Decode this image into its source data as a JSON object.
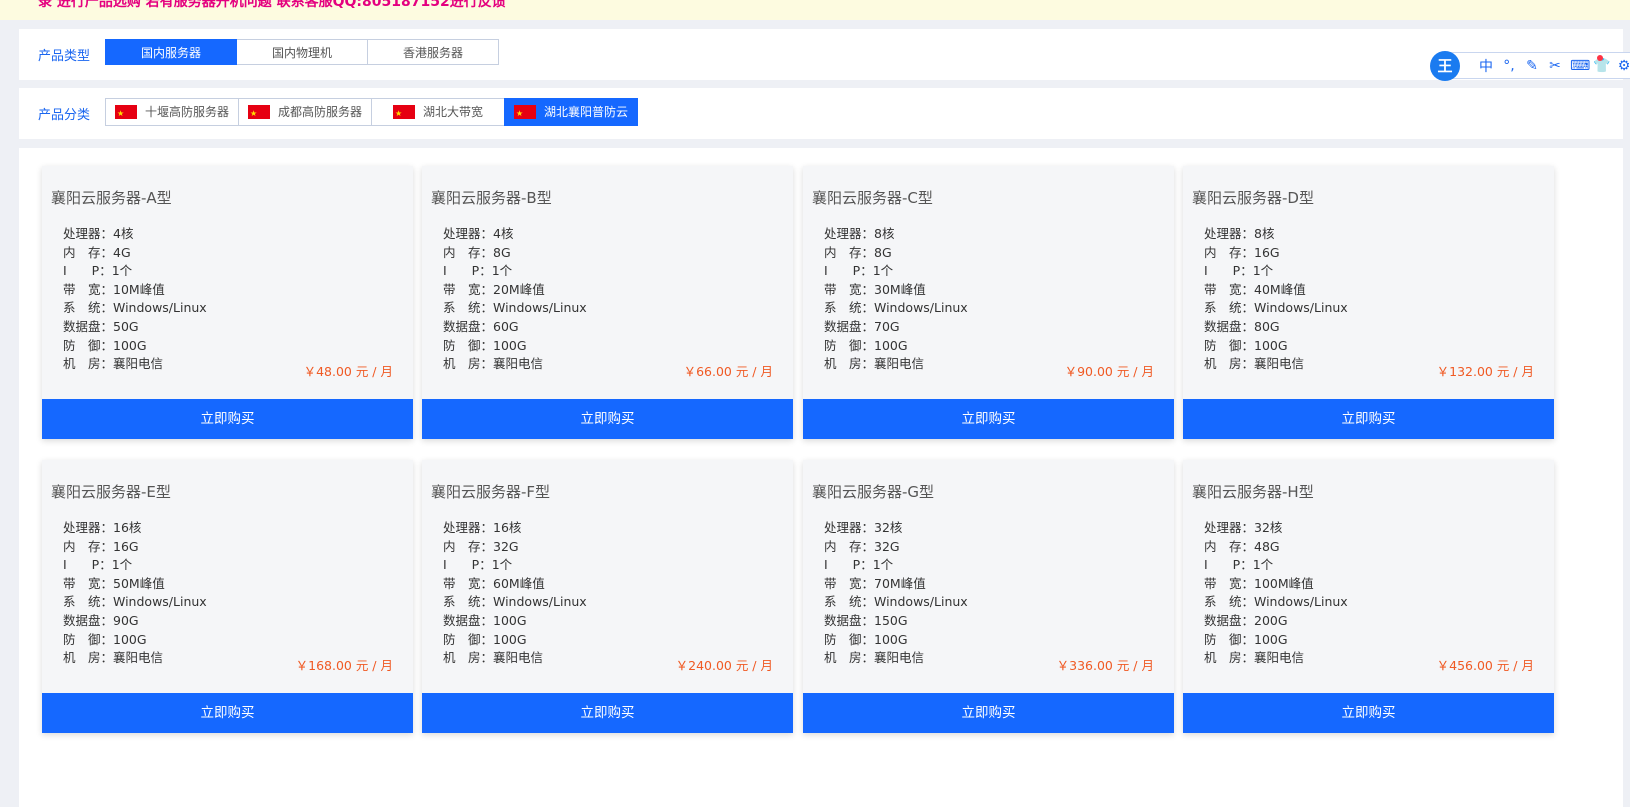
{
  "notice": "录 进行产品选购 若有服务器开机问题 联系客服QQ:805187152进行反馈",
  "product_type": {
    "label": "产品类型",
    "tabs": [
      "国内服务器",
      "国内物理机",
      "香港服务器"
    ],
    "active": 0
  },
  "product_category": {
    "label": "产品分类",
    "tabs": [
      "十堰高防服务器",
      "成都高防服务器",
      "湖北大带宽",
      "湖北襄阳普防云"
    ],
    "active": 3
  },
  "toolbar": {
    "logo": "王",
    "items": [
      "中",
      "°,",
      "✎",
      "✂",
      "⌨",
      "👕",
      "⚙"
    ]
  },
  "buy_label": "立即购买",
  "products": [
    {
      "title": "襄阳云服务器-A型",
      "specs": [
        "处理器：4核",
        "内　存：4G",
        "I　　P：1个",
        "带　宽：10M峰值",
        "系　统：Windows/Linux",
        "数据盘：50G",
        "防　御：100G",
        "机　房：襄阳电信"
      ],
      "price": "￥48.00 元 / 月"
    },
    {
      "title": "襄阳云服务器-B型",
      "specs": [
        "处理器：4核",
        "内　存：8G",
        "I　　P：1个",
        "带　宽：20M峰值",
        "系　统：Windows/Linux",
        "数据盘：60G",
        "防　御：100G",
        "机　房：襄阳电信"
      ],
      "price": "￥66.00 元 / 月"
    },
    {
      "title": "襄阳云服务器-C型",
      "specs": [
        "处理器：8核",
        "内　存：8G",
        "I　　P：1个",
        "带　宽：30M峰值",
        "系　统：Windows/Linux",
        "数据盘：70G",
        "防　御：100G",
        "机　房：襄阳电信"
      ],
      "price": "￥90.00 元 / 月"
    },
    {
      "title": "襄阳云服务器-D型",
      "specs": [
        "处理器：8核",
        "内　存：16G",
        "I　　P：1个",
        "带　宽：40M峰值",
        "系　统：Windows/Linux",
        "数据盘：80G",
        "防　御：100G",
        "机　房：襄阳电信"
      ],
      "price": "￥132.00 元 / 月"
    },
    {
      "title": "襄阳云服务器-E型",
      "specs": [
        "处理器：16核",
        "内　存：16G",
        "I　　P：1个",
        "带　宽：50M峰值",
        "系　统：Windows/Linux",
        "数据盘：90G",
        "防　御：100G",
        "机　房：襄阳电信"
      ],
      "price": "￥168.00 元 / 月"
    },
    {
      "title": "襄阳云服务器-F型",
      "specs": [
        "处理器：16核",
        "内　存：32G",
        "I　　P：1个",
        "带　宽：60M峰值",
        "系　统：Windows/Linux",
        "数据盘：100G",
        "防　御：100G",
        "机　房：襄阳电信"
      ],
      "price": "￥240.00 元 / 月"
    },
    {
      "title": "襄阳云服务器-G型",
      "specs": [
        "处理器：32核",
        "内　存：32G",
        "I　　P：1个",
        "带　宽：70M峰值",
        "系　统：Windows/Linux",
        "数据盘：150G",
        "防　御：100G",
        "机　房：襄阳电信"
      ],
      "price": "￥336.00 元 / 月"
    },
    {
      "title": "襄阳云服务器-H型",
      "specs": [
        "处理器：32核",
        "内　存：48G",
        "I　　P：1个",
        "带　宽：100M峰值",
        "系　统：Windows/Linux",
        "数据盘：200G",
        "防　御：100G",
        "机　房：襄阳电信"
      ],
      "price": "￥456.00 元 / 月"
    }
  ]
}
